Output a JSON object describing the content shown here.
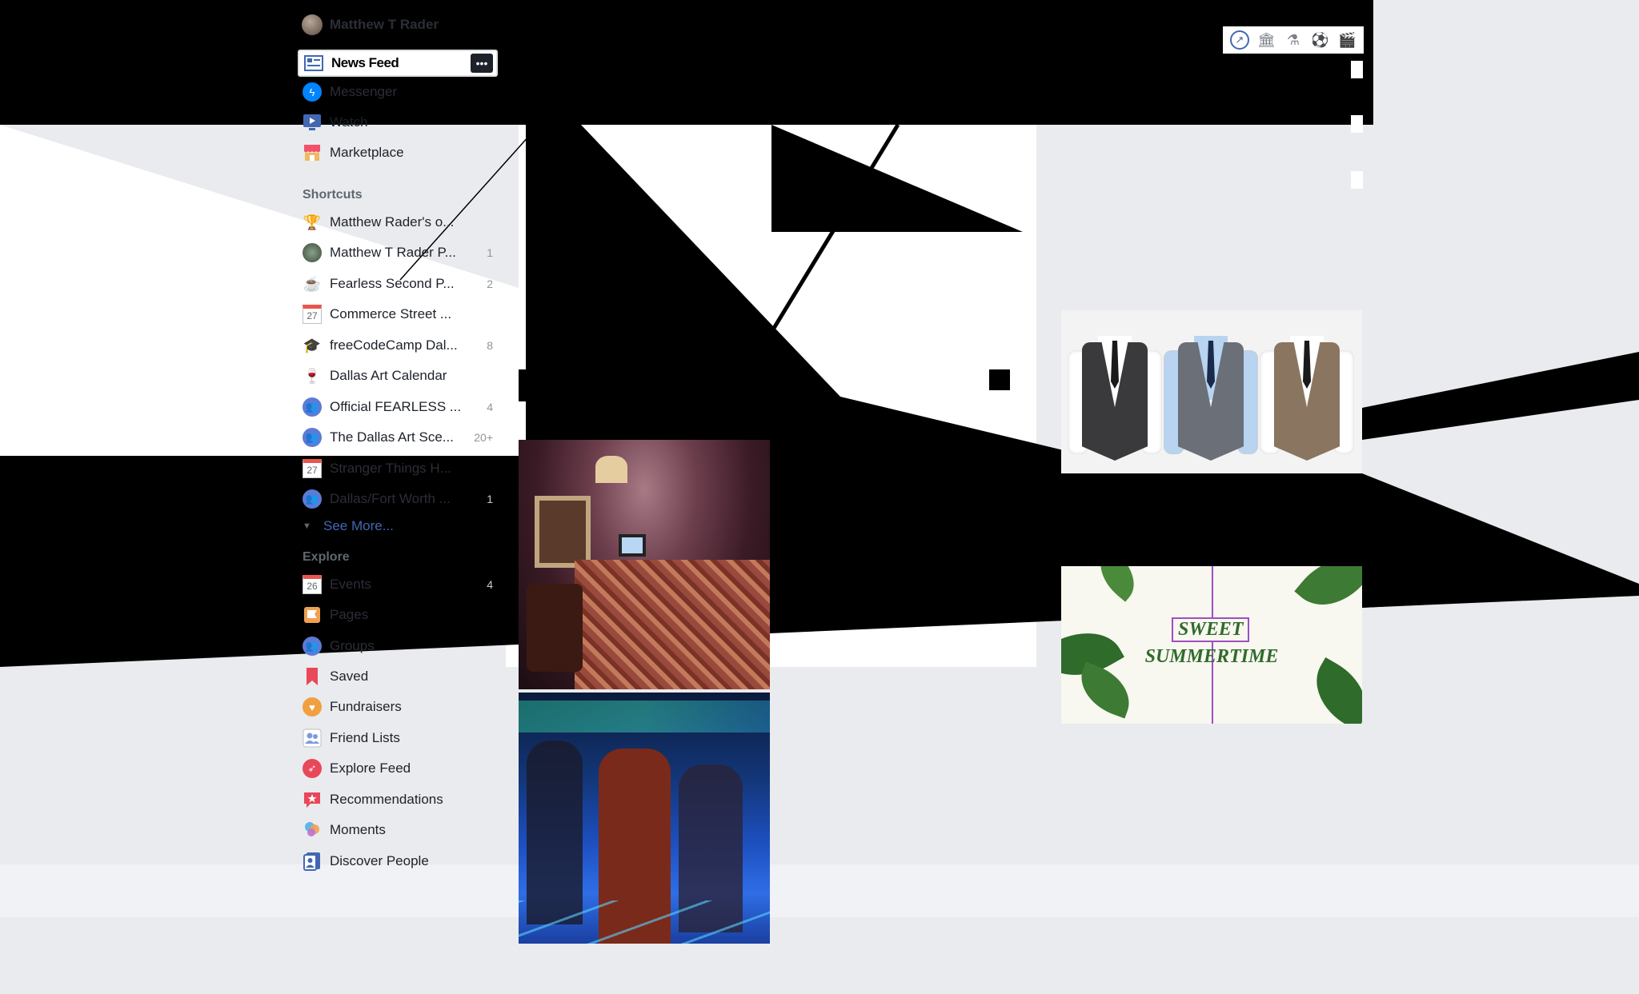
{
  "profile": {
    "name": "Matthew T Rader"
  },
  "nav": {
    "news_feed": "News Feed",
    "more_icon": "more-icon",
    "messenger": "Messenger",
    "watch": "Watch",
    "marketplace": "Marketplace"
  },
  "shortcuts": {
    "heading": "Shortcuts",
    "items": [
      {
        "label": "Matthew Rader's o...",
        "count": "",
        "icon": "trophy-icon"
      },
      {
        "label": "Matthew T Rader P...",
        "count": "1",
        "icon": "avatar-icon"
      },
      {
        "label": "Fearless Second P...",
        "count": "2",
        "icon": "coffee-icon"
      },
      {
        "label": "Commerce Street ...",
        "count": "",
        "icon": "calendar-icon",
        "day": "27"
      },
      {
        "label": "freeCodeCamp Dal...",
        "count": "8",
        "icon": "graduation-cap-icon"
      },
      {
        "label": "Dallas Art Calendar",
        "count": "",
        "icon": "wine-glass-icon"
      },
      {
        "label": "Official FEARLESS ...",
        "count": "4",
        "icon": "group-icon"
      },
      {
        "label": "The Dallas Art Sce...",
        "count": "20+",
        "icon": "group-icon"
      },
      {
        "label": "Stranger Things H...",
        "count": "",
        "icon": "calendar-icon",
        "day": "27"
      },
      {
        "label": "Dallas/Fort Worth ...",
        "count": "1",
        "icon": "group-icon"
      }
    ],
    "see_more": "See More..."
  },
  "explore": {
    "heading": "Explore",
    "items": [
      {
        "label": "Events",
        "count": "4",
        "icon": "calendar-icon",
        "day": "26"
      },
      {
        "label": "Pages",
        "count": "",
        "icon": "flag-icon"
      },
      {
        "label": "Groups",
        "count": "",
        "icon": "group-icon"
      },
      {
        "label": "Saved",
        "count": "",
        "icon": "bookmark-icon"
      },
      {
        "label": "Fundraisers",
        "count": "",
        "icon": "heart-coin-icon"
      },
      {
        "label": "Friend Lists",
        "count": "",
        "icon": "friends-icon"
      },
      {
        "label": "Explore Feed",
        "count": "",
        "icon": "rocket-icon"
      },
      {
        "label": "Recommendations",
        "count": "",
        "icon": "star-speech-icon"
      },
      {
        "label": "Moments",
        "count": "",
        "icon": "balloons-icon"
      },
      {
        "label": "Discover People",
        "count": "",
        "icon": "people-card-icon"
      }
    ]
  },
  "ads": {
    "summer_line1": "SWEET",
    "summer_line2": "SUMMERTIME"
  },
  "toolbar": {
    "icons": [
      "trending-icon",
      "bank-icon",
      "flask-icon",
      "soccer-ball-icon",
      "clapperboard-icon"
    ]
  },
  "colors": {
    "background": "#e9ebee",
    "link": "#4267b2",
    "muted": "#90949c",
    "accent_purple": "#a04ec0",
    "leaf_green": "#2f6b2a"
  }
}
